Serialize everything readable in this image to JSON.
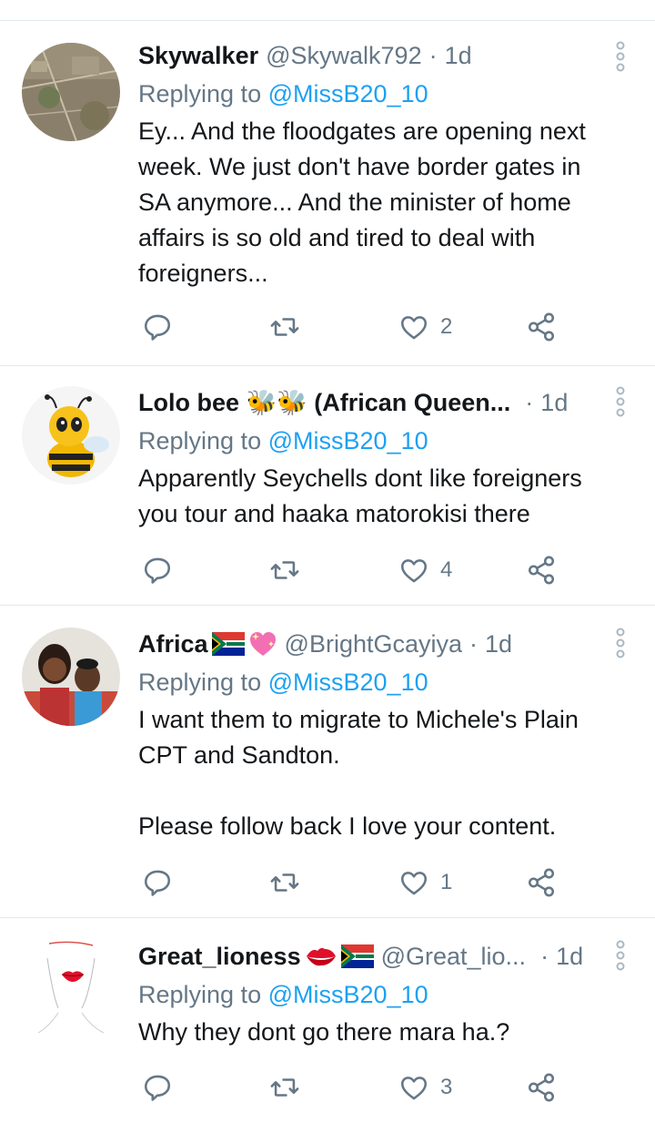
{
  "tweets": [
    {
      "name": "Skywalker",
      "handle": "@Skywalk792",
      "separator": "·",
      "time": "1d",
      "reply_prefix": "Replying to",
      "reply_to": "@MissB20_10",
      "body": "Ey... And the floodgates are opening next\nweek. We just don't have border gates in\nSA anymore... And the minister of home\naffairs is so old and tired to deal with\nforeigners...",
      "likes": "2",
      "emoji": []
    },
    {
      "name": "Lolo bee 🐝🐝 (African Queen...",
      "handle": "",
      "separator": "·",
      "time": "1d",
      "reply_prefix": "Replying to",
      "reply_to": "@MissB20_10",
      "body": "Apparently Seychells dont like foreigners\nyou tour and haaka matorokisi there",
      "likes": "4",
      "emoji": [
        "bee-emoji",
        "bee-emoji"
      ]
    },
    {
      "name": "Africa",
      "handle": "@BrightGcayiya",
      "separator": "·",
      "time": "1d",
      "reply_prefix": "Replying to",
      "reply_to": "@MissB20_10",
      "body": "I want them to migrate to Michele's Plain\nCPT and Sandton.\n\nPlease follow back I love your content.",
      "likes": "1",
      "emoji": [
        "south-africa-flag-emoji",
        "sparkling-heart-emoji"
      ]
    },
    {
      "name": "Great_lioness",
      "handle": "@Great_lio...",
      "separator": "·",
      "time": "1d",
      "reply_prefix": "Replying to",
      "reply_to": "@MissB20_10",
      "body": "Why they dont go there mara ha.?",
      "likes": "3",
      "emoji": [
        "kiss-mark-emoji",
        "south-africa-flag-emoji"
      ]
    }
  ],
  "colors": {
    "link": "#1da1f2",
    "muted": "#657786",
    "text": "#14171a",
    "divider": "#e1e8ed"
  },
  "icons": {
    "reply": "reply-icon",
    "retweet": "retweet-icon",
    "like": "like-icon",
    "share": "share-icon",
    "more": "more-options-icon"
  }
}
